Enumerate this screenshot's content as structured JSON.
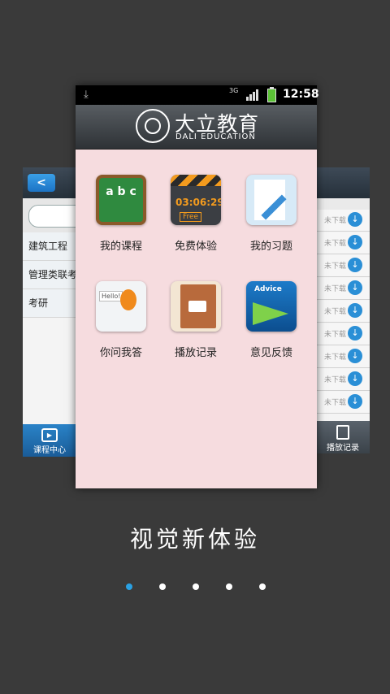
{
  "status_bar": {
    "network": "3G",
    "time": "12:58"
  },
  "header": {
    "brand_cn": "大立教育",
    "brand_en": "DALI EDUCATION"
  },
  "grid": [
    {
      "label": "我的课程",
      "icon": "chalkboard-icon",
      "icon_text": "a b c"
    },
    {
      "label": "免费体验",
      "icon": "clapper-icon",
      "icon_text": "03:06:29",
      "icon_sub": "Free"
    },
    {
      "label": "我的习题",
      "icon": "document-pen-icon"
    },
    {
      "label": "你问我答",
      "icon": "hello-mascot-icon",
      "icon_text": "Hello!"
    },
    {
      "label": "播放记录",
      "icon": "video-notebook-icon"
    },
    {
      "label": "意见反馈",
      "icon": "paper-plane-icon",
      "icon_text": "Advice"
    }
  ],
  "left_card": {
    "back_icon": "chevron-left-icon",
    "items": [
      "建筑工程",
      "管理类联考",
      "考研"
    ],
    "tab_label": "课程中心"
  },
  "right_card": {
    "rows": [
      "未下载",
      "未下载",
      "未下载",
      "未下载",
      "未下载",
      "未下载",
      "未下载",
      "未下载",
      "未下载"
    ],
    "tab_label": "播放记录"
  },
  "caption": "视觉新体验",
  "pager": {
    "count": 5,
    "active": 0
  },
  "colors": {
    "accent": "#2aa1e3",
    "background": "#3a3a3a",
    "phone_bg": "#f6dcdf"
  }
}
